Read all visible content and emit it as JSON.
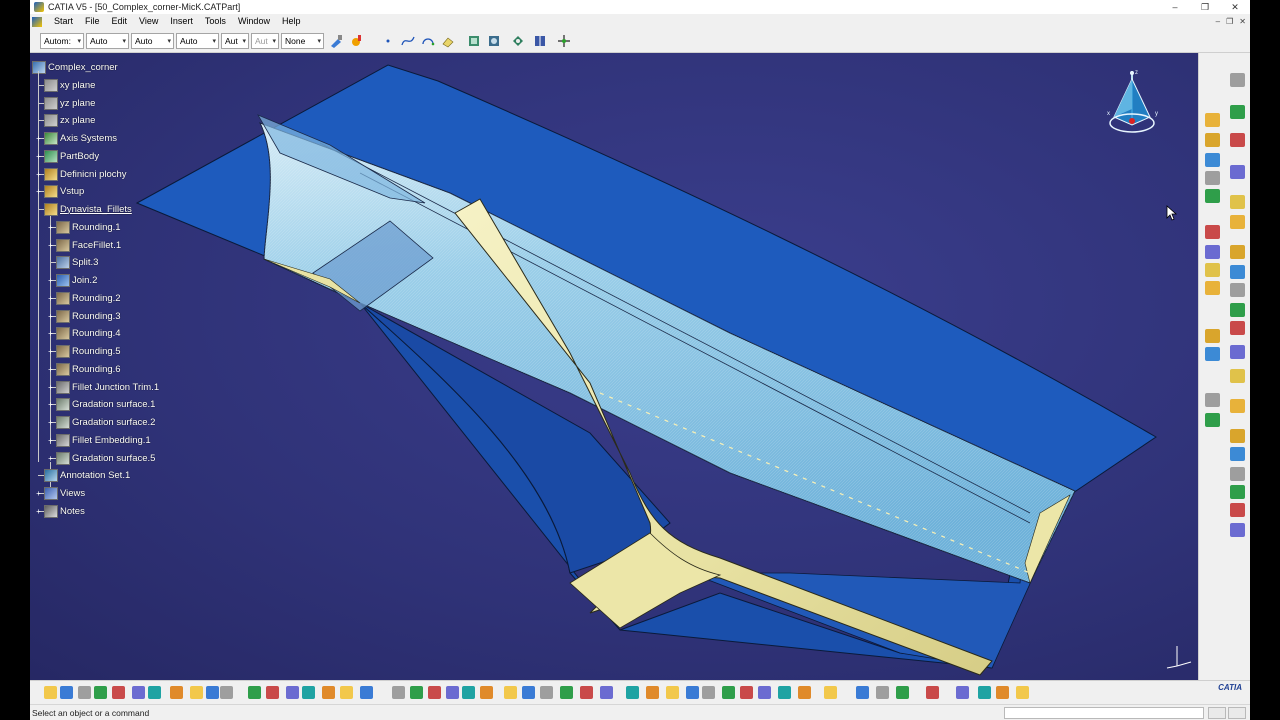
{
  "window": {
    "title": "CATIA V5 - [50_Complex_corner-MicK.CATPart]",
    "controls": [
      "–",
      "❐",
      "✕"
    ]
  },
  "menubar": {
    "items": [
      "Start",
      "File",
      "Edit",
      "View",
      "Insert",
      "Tools",
      "Window",
      "Help"
    ],
    "mdi_controls": [
      "–",
      "❐",
      "✕"
    ]
  },
  "toolbar": {
    "combos": [
      {
        "value": "Autom:"
      },
      {
        "value": "Auto"
      },
      {
        "value": "Auto"
      },
      {
        "value": "Auto"
      },
      {
        "value": "Aut"
      },
      {
        "value": "Aut"
      },
      {
        "value": "None"
      }
    ]
  },
  "tree": {
    "root": "Complex_corner",
    "items": [
      {
        "label": "xy plane",
        "depth": 1,
        "icon": "plane-icon"
      },
      {
        "label": "yz plane",
        "depth": 1,
        "icon": "plane-icon"
      },
      {
        "label": "zx plane",
        "depth": 1,
        "icon": "plane-icon"
      },
      {
        "label": "Axis Systems",
        "depth": 1,
        "icon": "axis-system-icon",
        "expandable": true
      },
      {
        "label": "PartBody",
        "depth": 1,
        "icon": "partbody-icon",
        "expandable": true
      },
      {
        "label": "Definicni plochy",
        "depth": 1,
        "icon": "geometrical-set-icon",
        "expandable": true
      },
      {
        "label": "Vstup",
        "depth": 1,
        "icon": "geometrical-set-icon",
        "expandable": true
      },
      {
        "label": "Dynavista_Fillets",
        "depth": 1,
        "icon": "geometrical-set-icon",
        "expanded": true,
        "underlined": true
      },
      {
        "label": "Rounding.1",
        "depth": 2,
        "icon": "rounding-icon",
        "expandable": true
      },
      {
        "label": "FaceFillet.1",
        "depth": 2,
        "icon": "face-fillet-icon",
        "expandable": true
      },
      {
        "label": "Split.3",
        "depth": 2,
        "icon": "split-icon"
      },
      {
        "label": "Join.2",
        "depth": 2,
        "icon": "join-icon",
        "expandable": true
      },
      {
        "label": "Rounding.2",
        "depth": 2,
        "icon": "rounding-icon",
        "expandable": true
      },
      {
        "label": "Rounding.3",
        "depth": 2,
        "icon": "rounding-icon",
        "expandable": true
      },
      {
        "label": "Rounding.4",
        "depth": 2,
        "icon": "rounding-icon",
        "expandable": true
      },
      {
        "label": "Rounding.5",
        "depth": 2,
        "icon": "rounding-icon",
        "expandable": true
      },
      {
        "label": "Rounding.6",
        "depth": 2,
        "icon": "rounding-icon",
        "expandable": true
      },
      {
        "label": "Fillet Junction Trim.1",
        "depth": 2,
        "icon": "fillet-junction-icon",
        "expandable": true
      },
      {
        "label": "Gradation surface.1",
        "depth": 2,
        "icon": "gradation-surface-icon",
        "expandable": true
      },
      {
        "label": "Gradation surface.2",
        "depth": 2,
        "icon": "gradation-surface-icon",
        "expandable": true
      },
      {
        "label": "Fillet Embedding.1",
        "depth": 2,
        "icon": "fillet-embedding-icon",
        "expandable": true
      },
      {
        "label": "Gradation surface.5",
        "depth": 2,
        "icon": "gradation-surface-icon",
        "expandable": true
      },
      {
        "label": "Annotation Set.1",
        "depth": 0,
        "icon": "annotation-set-icon",
        "expanded": true
      },
      {
        "label": "Views",
        "depth": 1,
        "icon": "views-icon",
        "expandable": true
      },
      {
        "label": "Notes",
        "depth": 1,
        "icon": "notes-icon",
        "expandable": true
      }
    ]
  },
  "compass": {
    "axis_labels": [
      "z",
      "y",
      "x"
    ]
  },
  "statusbar": {
    "message": "Select an object or a command"
  },
  "colors": {
    "background": "#2f3277",
    "surface_blue": "#1f56b3",
    "surface_light": "#8ec8e6",
    "fillet": "#efeab0",
    "ui_gray": "#f0f0f0"
  },
  "branding": {
    "logo": "CATIA"
  }
}
